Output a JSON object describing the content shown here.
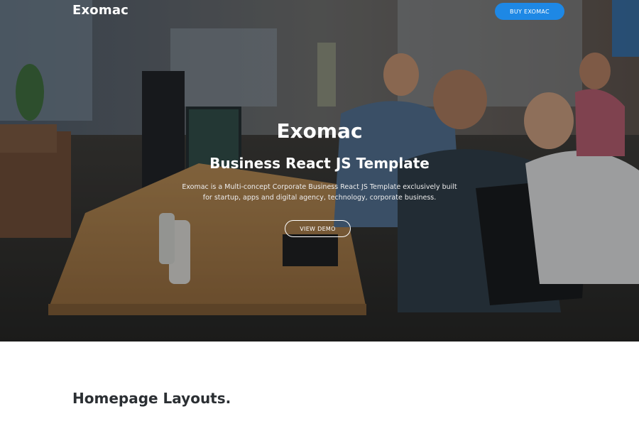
{
  "header": {
    "brand": "Exomac",
    "buy_button": "BUY EXOMAC"
  },
  "hero": {
    "title": "Exomac",
    "subtitle": "Business React JS Template",
    "description": "Exomac is a Multi-concept Corporate Business React JS Template exclusively built for startup, apps and digital agency, technology, corporate business.",
    "demo_button": "VIEW DEMO"
  },
  "layouts": {
    "title": "Homepage Layouts."
  },
  "colors": {
    "accent": "#1e88e5",
    "heading": "#2b2f33"
  }
}
